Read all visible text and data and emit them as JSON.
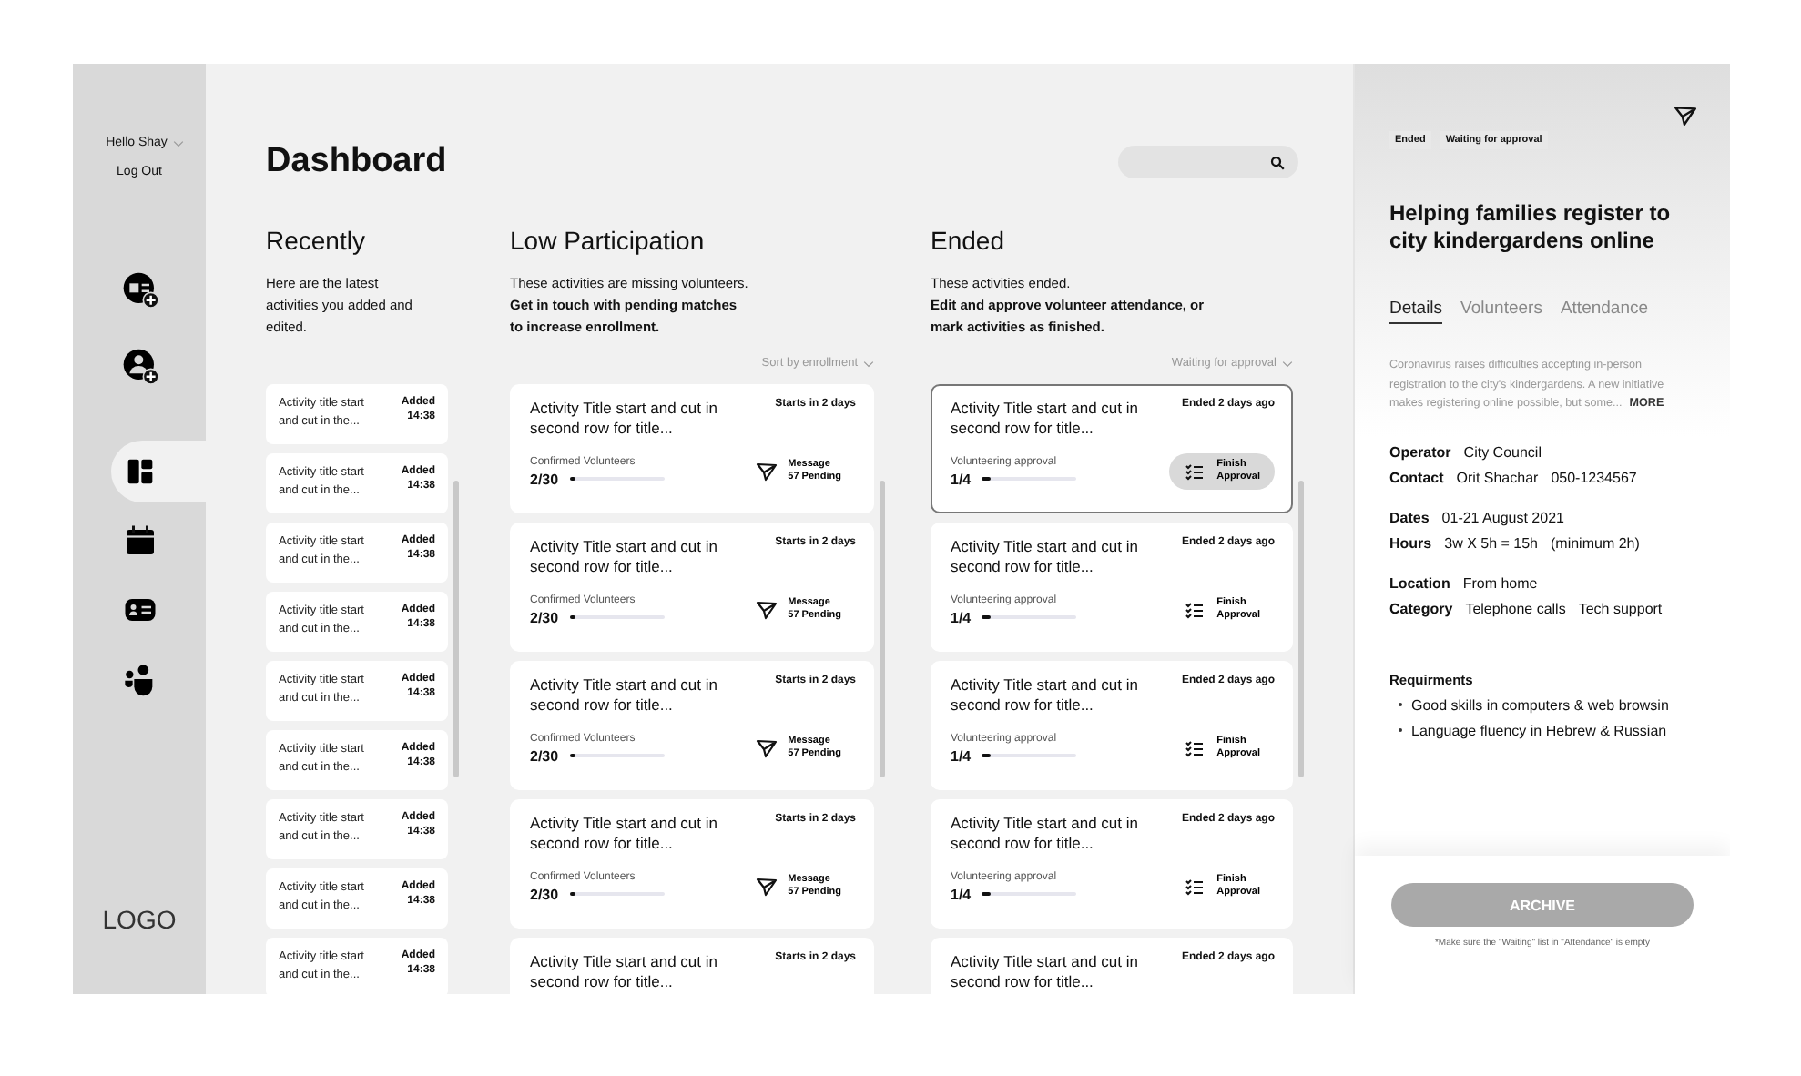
{
  "sidebar": {
    "greeting": "Hello Shay",
    "logout": "Log Out",
    "logo": "LOGO",
    "nav": [
      {
        "kind": "add-activity",
        "selected": false
      },
      {
        "kind": "add-volunteer",
        "selected": false
      },
      {
        "kind": "dashboard",
        "selected": true
      },
      {
        "kind": "calendar",
        "selected": false
      },
      {
        "kind": "id-card",
        "selected": false
      },
      {
        "kind": "people",
        "selected": false
      }
    ]
  },
  "header": {
    "title": "Dashboard"
  },
  "recently": {
    "title": "Recently",
    "description": "Here are the latest activities you added and edited.",
    "items": [
      {
        "title": "Activity title start and cut in the...",
        "tag": "Added",
        "time": "14:38"
      },
      {
        "title": "Activity title start and cut in the...",
        "tag": "Added",
        "time": "14:38"
      },
      {
        "title": "Activity title start and cut in the...",
        "tag": "Added",
        "time": "14:38"
      },
      {
        "title": "Activity title start and cut in the...",
        "tag": "Added",
        "time": "14:38"
      },
      {
        "title": "Activity title start and cut in the...",
        "tag": "Added",
        "time": "14:38"
      },
      {
        "title": "Activity title start and cut in the...",
        "tag": "Added",
        "time": "14:38"
      },
      {
        "title": "Activity title start and cut in the...",
        "tag": "Added",
        "time": "14:38"
      },
      {
        "title": "Activity title start and cut in the...",
        "tag": "Added",
        "time": "14:38"
      },
      {
        "title": "Activity title start and cut in the...",
        "tag": "Added",
        "time": "14:38"
      }
    ]
  },
  "low_participation": {
    "title": "Low Participation",
    "description": "These activities are missing volunteers.",
    "instruction": "Get in touch with pending matches to increase enrollment.",
    "sort": "Sort by enrollment",
    "cards": [
      {
        "title": "Activity Title start and cut in second row for title...",
        "timing": "Starts in 2 days",
        "progress_label": "Confirmed Volunteers",
        "count": "2/30",
        "level": 0.07,
        "action": {
          "kind": "message",
          "label": "Message",
          "sub": "57 Pending"
        },
        "selected": false
      },
      {
        "title": "Activity Title start and cut in second row for title...",
        "timing": "Starts in 2 days",
        "progress_label": "Confirmed Volunteers",
        "count": "2/30",
        "level": 0.07,
        "action": {
          "kind": "message",
          "label": "Message",
          "sub": "57 Pending"
        },
        "selected": false
      },
      {
        "title": "Activity Title start and cut in second row for title...",
        "timing": "Starts in 2 days",
        "progress_label": "Confirmed Volunteers",
        "count": "2/30",
        "level": 0.07,
        "action": {
          "kind": "message",
          "label": "Message",
          "sub": "57 Pending"
        },
        "selected": false
      },
      {
        "title": "Activity Title start and cut in second row for title...",
        "timing": "Starts in 2 days",
        "progress_label": "Confirmed Volunteers",
        "count": "2/30",
        "level": 0.07,
        "action": {
          "kind": "message",
          "label": "Message",
          "sub": "57 Pending"
        },
        "selected": false
      },
      {
        "title": "Activity Title start and cut in second row for title...",
        "timing": "Starts in 2 days",
        "selected": false
      }
    ]
  },
  "ended": {
    "title": "Ended",
    "description": "These activities ended.",
    "instruction": "Edit and approve volunteer attendance, or mark activities as finished.",
    "sort": "Waiting for approval",
    "cards": [
      {
        "title": "Activity Title start and cut in second row for title...",
        "timing": "Ended 2 days ago",
        "progress_label": "Volunteering approval",
        "count": "1/4",
        "level": 0.1,
        "action": {
          "kind": "checklist",
          "label": "Finish",
          "sub": "Approval"
        },
        "selected": true
      },
      {
        "title": "Activity Title start and cut in second row for title...",
        "timing": "Ended 2 days ago",
        "progress_label": "Volunteering approval",
        "count": "1/4",
        "level": 0.1,
        "action": {
          "kind": "checklist",
          "label": "Finish",
          "sub": "Approval"
        },
        "selected": false
      },
      {
        "title": "Activity Title start and cut in second row for title...",
        "timing": "Ended 2 days ago",
        "progress_label": "Volunteering approval",
        "count": "1/4",
        "level": 0.1,
        "action": {
          "kind": "checklist",
          "label": "Finish",
          "sub": "Approval"
        },
        "selected": false
      },
      {
        "title": "Activity Title start and cut in second row for title...",
        "timing": "Ended 2 days ago",
        "progress_label": "Volunteering approval",
        "count": "1/4",
        "level": 0.1,
        "action": {
          "kind": "checklist",
          "label": "Finish",
          "sub": "Approval"
        },
        "selected": false
      },
      {
        "title": "Activity Title start and cut in second row for title...",
        "timing": "Ended 2 days ago",
        "selected": false
      }
    ]
  },
  "detail": {
    "tags": [
      "Ended",
      "Waiting for approval"
    ],
    "title": "Helping families register to city kindergardens online",
    "tabs": [
      {
        "label": "Details",
        "selected": true
      },
      {
        "label": "Volunteers",
        "selected": false
      },
      {
        "label": "Attendance",
        "selected": false
      }
    ],
    "description": "Coronavirus raises difficulties accepting in-person registration to the city's kindergardens. A new initiative makes registering online possible, but some...",
    "more": "MORE",
    "groups": [
      [
        {
          "label": "Operator",
          "values": [
            "City Council"
          ]
        },
        {
          "label": "Contact",
          "values": [
            "Orit Shachar",
            "050-1234567"
          ]
        }
      ],
      [
        {
          "label": "Dates",
          "values": [
            "01-21 August 2021"
          ]
        },
        {
          "label": "Hours",
          "values": [
            "3w X 5h = 15h",
            "(minimum 2h)"
          ]
        }
      ],
      [
        {
          "label": "Location",
          "values": [
            "From home"
          ]
        },
        {
          "label": "Category",
          "values": [
            "Telephone calls",
            "Tech support"
          ]
        }
      ]
    ],
    "requirements": {
      "title": "Requirments",
      "items": [
        "Good skills in computers & web browsin",
        "Language fluency in Hebrew & Russian"
      ]
    },
    "archive": {
      "label": "ARCHIVE",
      "disabled": true
    },
    "note": "*Make sure the \"Waiting\" list in \"Attendance\" is empty"
  }
}
